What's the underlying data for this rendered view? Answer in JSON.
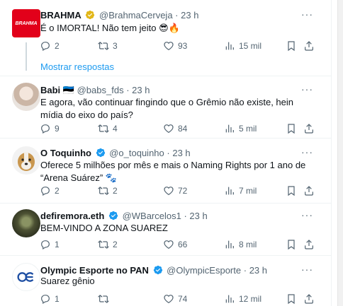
{
  "tweets": [
    {
      "name": "BRAHMA",
      "handle": "@BrahmaCerveja",
      "time": "23 h",
      "text": "É o IMORTAL! Não tem jeito 😎🔥",
      "replies": "2",
      "retweets": "3",
      "likes": "93",
      "views": "15 mil",
      "avatar_text": "BRAHMA"
    },
    {
      "name": "Babi 🇪🇪",
      "handle": "@babs_fds",
      "time": "23 h",
      "text": "E agora, vão continuar fingindo que o Grêmio não existe, hein mídia do eixo do país?",
      "replies": "9",
      "retweets": "4",
      "likes": "84",
      "views": "5 mil"
    },
    {
      "name": "O Toquinho",
      "handle": "@o_toquinho",
      "time": "23 h",
      "text": "Oferece 5 milhões por mês e mais o Naming Rights por 1 ano de “Arena Suárez” 🐾",
      "replies": "2",
      "retweets": "2",
      "likes": "72",
      "views": "7 mil"
    },
    {
      "name": "defiremora.eth",
      "handle": "@WBarcelos1",
      "time": "23 h",
      "text": "BEM-VINDO A ZONA SUAREZ",
      "replies": "1",
      "retweets": "2",
      "likes": "66",
      "views": "8 mil"
    },
    {
      "name": "Olympic Esporte no PAN",
      "handle": "@OlympicEsporte",
      "time": "23 h",
      "text": "Suarez gênio",
      "replies": "1",
      "retweets": "",
      "likes": "74",
      "views": "12 mil"
    }
  ],
  "thread": {
    "show_replies": "Mostrar respostas"
  },
  "colors": {
    "accent": "#1d9bf0",
    "muted": "#536471",
    "brahma_red": "#e2001a"
  },
  "icons": [
    "reply-icon",
    "retweet-icon",
    "like-icon",
    "views-icon",
    "bookmark-icon",
    "share-icon",
    "verified-badge-icon",
    "more-icon"
  ]
}
